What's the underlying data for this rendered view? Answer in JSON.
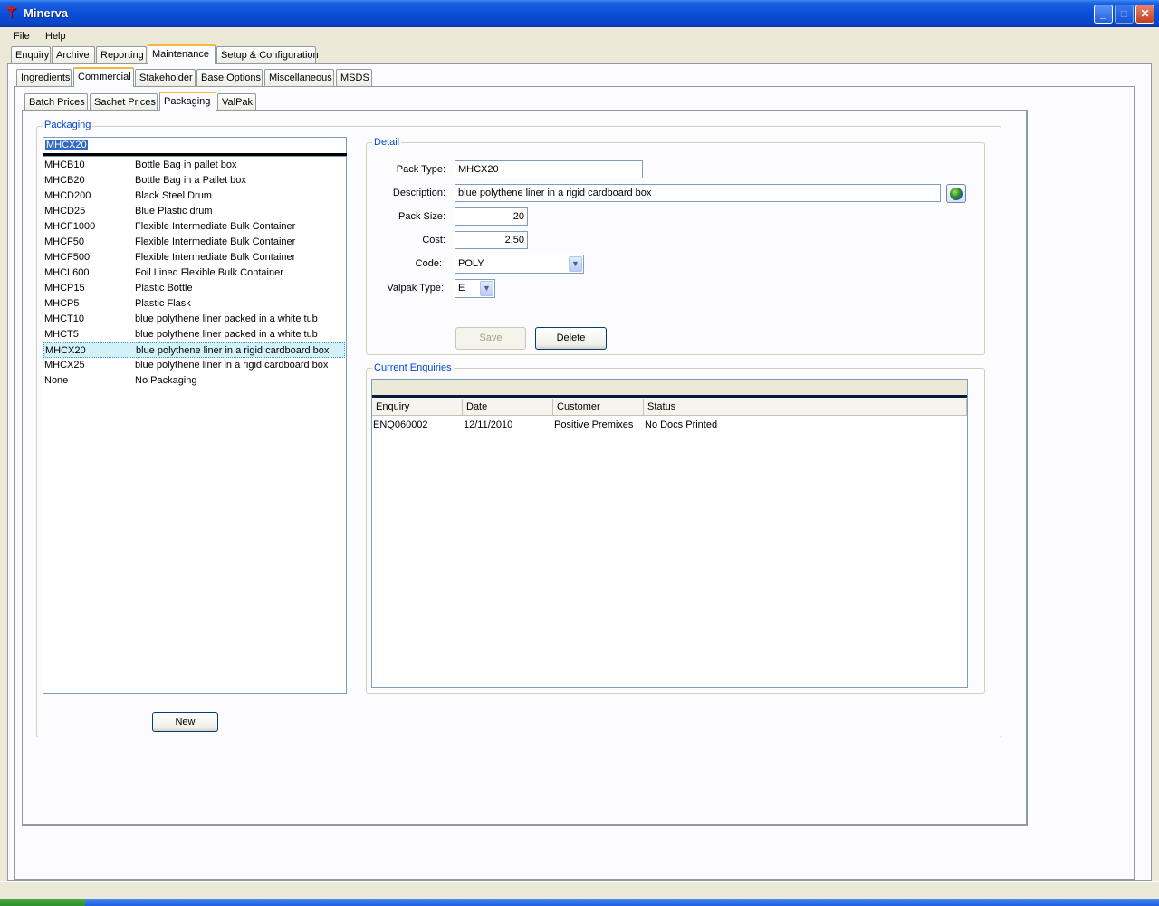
{
  "window": {
    "title": "Minerva",
    "icon": "minerva-logo-icon"
  },
  "menu": {
    "items": [
      "File",
      "Help"
    ]
  },
  "main_tabs": [
    "Enquiry",
    "Archive",
    "Reporting",
    "Maintenance",
    "Setup & Configuration"
  ],
  "main_tab_active": "Maintenance",
  "maint_tabs": [
    "Ingredients",
    "Commercial",
    "Stakeholder",
    "Base Options",
    "Miscellaneous",
    "MSDS"
  ],
  "maint_tab_active": "Commercial",
  "commercial_tabs": [
    "Batch Prices",
    "Sachet Prices",
    "Packaging",
    "ValPak"
  ],
  "commercial_tab_active": "Packaging",
  "packaging": {
    "group_label": "Packaging",
    "search_value": "MHCX20",
    "items": [
      {
        "code": "MHCB10",
        "desc": "Bottle Bag in pallet box"
      },
      {
        "code": "MHCB20",
        "desc": "Bottle Bag in a Pallet box"
      },
      {
        "code": "MHCD200",
        "desc": "Black Steel Drum"
      },
      {
        "code": "MHCD25",
        "desc": "Blue Plastic drum"
      },
      {
        "code": "MHCF1000",
        "desc": "Flexible Intermediate Bulk Container"
      },
      {
        "code": "MHCF50",
        "desc": "Flexible Intermediate Bulk Container"
      },
      {
        "code": "MHCF500",
        "desc": "Flexible Intermediate Bulk Container"
      },
      {
        "code": "MHCL600",
        "desc": "Foil Lined Flexible Bulk Container"
      },
      {
        "code": "MHCP15",
        "desc": "Plastic Bottle"
      },
      {
        "code": "MHCP5",
        "desc": "Plastic Flask"
      },
      {
        "code": "MHCT10",
        "desc": "blue polythene liner packed in a white tub"
      },
      {
        "code": "MHCT5",
        "desc": "blue polythene liner packed in a white tub"
      },
      {
        "code": "MHCX20",
        "desc": "blue polythene liner in a rigid cardboard box"
      },
      {
        "code": "MHCX25",
        "desc": "blue polythene liner in a rigid cardboard box"
      },
      {
        "code": "None",
        "desc": "No Packaging"
      }
    ],
    "selected_index": 12,
    "new_label": "New"
  },
  "detail": {
    "group_label": "Detail",
    "pack_type_label": "Pack Type:",
    "pack_type": "MHCX20",
    "description_label": "Description:",
    "description": "blue polythene liner in a rigid cardboard box",
    "pack_size_label": "Pack Size:",
    "pack_size": "20",
    "cost_label": "Cost:",
    "cost": "2.50",
    "code_label": "Code:",
    "code": "POLY",
    "valpak_label": "Valpak Type:",
    "valpak": "E",
    "save_label": "Save",
    "delete_label": "Delete",
    "translate_icon": "globe-icon"
  },
  "enquiries": {
    "group_label": "Current Enquiries",
    "columns": [
      "Enquiry",
      "Date",
      "Customer",
      "Status"
    ],
    "rows": [
      [
        "ENQ060002",
        "12/11/2010",
        "Positive Premixes",
        "No Docs Printed"
      ]
    ]
  }
}
